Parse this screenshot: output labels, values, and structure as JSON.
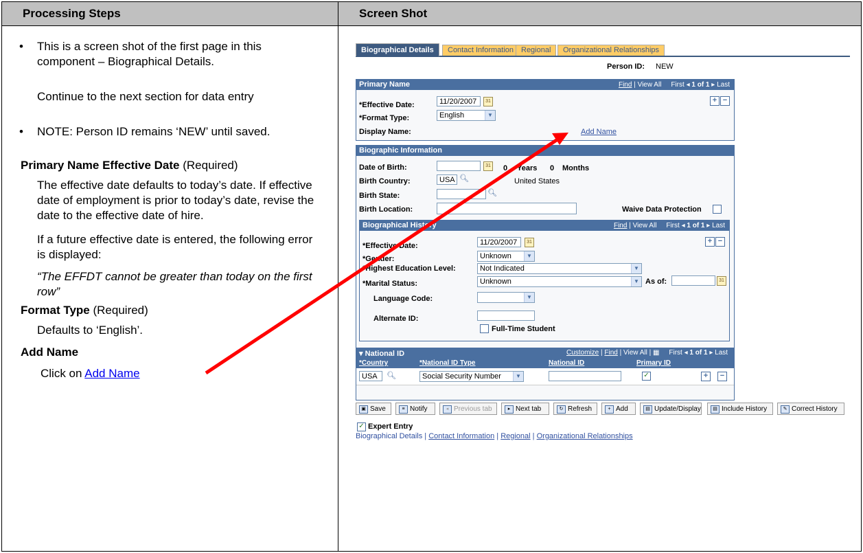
{
  "headers": {
    "left": "Processing Steps",
    "right": "Screen Shot"
  },
  "left": {
    "bullet1_a": "This is a screen shot of the first page in this component – Biographical Details.",
    "bullet1_b": "Continue to the next section for data entry",
    "bullet2": "NOTE: Person ID remains ‘NEW’ until saved.",
    "sec1_title": "Primary Name Effective Date",
    "sec1_req": " (Required)",
    "sec1_p1": "The effective date defaults to today’s date.  If effective date of employment is prior to today’s date, revise the date to the effective date of hire.",
    "sec1_p2": "If a future effective date is entered, the following error is displayed:",
    "sec1_p3": "“The EFFDT cannot be greater than today on the first row”",
    "sec2_title": "Format Type",
    "sec2_req": " (Required)",
    "sec2_p1": "Defaults to ‘English’.",
    "sec3_title": "Add Name",
    "sec3_p1": "Click on ",
    "sec3_link": "Add Name"
  },
  "tabs": [
    "Biographical Details",
    "Contact Information",
    "Regional",
    "Organizational Relationships"
  ],
  "person_id": {
    "label": "Person ID:",
    "value": "NEW"
  },
  "primary_name": {
    "title": "Primary Name",
    "nav_find": "Find",
    "nav_view": " | View All",
    "nav_first": "First",
    "nav_count": "1 of 1",
    "nav_last": "Last",
    "eff_label": "*Effective Date:",
    "eff_value": "11/20/2007",
    "format_label": "*Format Type:",
    "format_value": "English",
    "display_label": "Display Name:",
    "add_name": "Add Name"
  },
  "bio_info": {
    "title": "Biographic Information",
    "dob_label": "Date of Birth:",
    "years_num": "0",
    "years_label": "Years",
    "months_num": "0",
    "months_label": "Months",
    "country_label": "Birth Country:",
    "country_value": "USA",
    "country_desc": "United States",
    "state_label": "Birth State:",
    "location_label": "Birth Location:",
    "waive_label": "Waive Data Protection"
  },
  "bio_history": {
    "title": "Biographical History",
    "nav_find": "Find",
    "nav_view": " | View All",
    "nav_first": "First",
    "nav_count": "1 of 1",
    "nav_last": "Last",
    "eff_label": "*Effective Date:",
    "eff_value": "11/20/2007",
    "gender_label": "*Gender:",
    "gender_value": "Unknown",
    "edu_label": "*Highest Education Level:",
    "edu_value": "Not Indicated",
    "marital_label": "*Marital Status:",
    "marital_value": "Unknown",
    "asof_label": "As of:",
    "lang_label": "Language Code:",
    "alt_label": "Alternate ID:",
    "fts_label": "Full-Time Student"
  },
  "national_id": {
    "title": "▾ National ID",
    "nav_customize": "Customize",
    "nav_find": "Find",
    "nav_view": "View All",
    "nav_first": "First",
    "nav_count": "1 of 1",
    "nav_last": "Last",
    "col_country": "*Country",
    "col_type": "*National ID Type",
    "col_id": "National ID",
    "col_primary": "Primary ID",
    "row_country": "USA",
    "row_type": "Social Security Number",
    "row_id": ""
  },
  "buttons": {
    "save": "Save",
    "notify": "Notify",
    "prev": "Previous tab",
    "next": "Next tab",
    "refresh": "Refresh",
    "add": "Add",
    "update": "Update/Display",
    "include": "Include History",
    "correct": "Correct History"
  },
  "expert_entry": "Expert Entry",
  "footer_links": [
    "Biographical Details",
    "Contact Information",
    "Regional",
    "Organizational Relationships"
  ],
  "colors": {
    "header_bg": "#c0c0c0",
    "box_header": "#4a6fa0",
    "tab_inactive": "#ffcc66",
    "arrow": "#ff0000",
    "link": "#0000ee"
  }
}
